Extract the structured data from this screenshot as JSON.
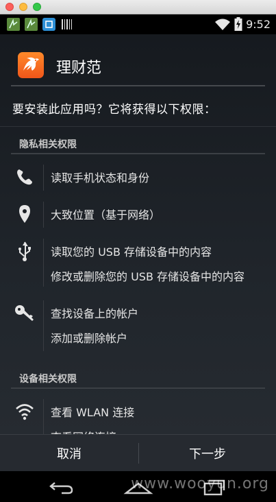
{
  "status_bar": {
    "time": "9:52",
    "left_icons": [
      "notification-icon",
      "notification-icon",
      "screen-icon",
      "barcode-icon"
    ],
    "right_icons": [
      "wifi-icon",
      "battery-charging-icon"
    ]
  },
  "app": {
    "name": "理财范",
    "icon": "app-logo-icon",
    "brand_color": "#f5661d"
  },
  "install_prompt": {
    "question": "要安装此应用吗？它将获得以下权限："
  },
  "sections": [
    {
      "title": "隐私相关权限",
      "permissions": [
        {
          "icon": "phone-icon",
          "lines": [
            "读取手机状态和身份"
          ]
        },
        {
          "icon": "location-pin-icon",
          "lines": [
            "大致位置（基于网络）"
          ]
        },
        {
          "icon": "usb-icon",
          "lines": [
            "读取您的 USB 存储设备中的内容",
            "修改或删除您的 USB 存储设备中的内容"
          ]
        },
        {
          "icon": "key-icon",
          "lines": [
            "查找设备上的帐户",
            "添加或删除帐户"
          ]
        }
      ]
    },
    {
      "title": "设备相关权限",
      "permissions": [
        {
          "icon": "wifi-icon",
          "lines": [
            "查看 WLAN 连接",
            "查看网络连接"
          ]
        }
      ]
    }
  ],
  "buttons": {
    "cancel": "取消",
    "next": "下一步"
  },
  "nav_bar": {
    "icons": [
      "back-icon",
      "home-icon",
      "recents-icon"
    ]
  },
  "watermark": "www.wooyun.org"
}
